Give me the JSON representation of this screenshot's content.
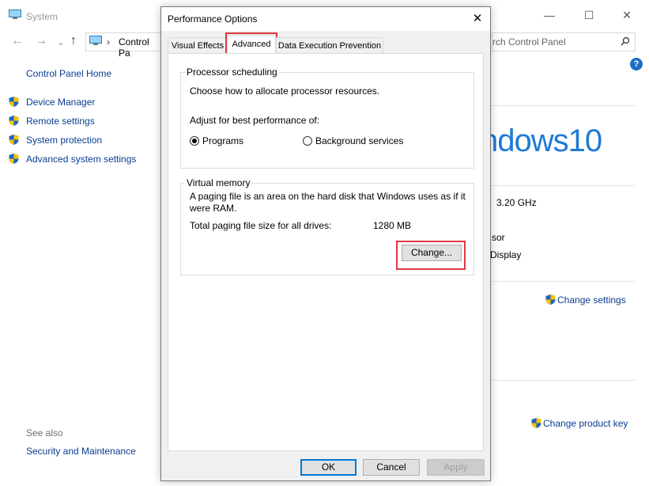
{
  "system_window": {
    "title": "System",
    "address": "Control Pa",
    "search_placeholder": "rch Control Panel",
    "sidebar": {
      "home": "Control Panel Home",
      "items": [
        {
          "label": "Device Manager",
          "icon": "shield-icon"
        },
        {
          "label": "Remote settings",
          "icon": "shield-icon"
        },
        {
          "label": "System protection",
          "icon": "shield-icon"
        },
        {
          "label": "Advanced system settings",
          "icon": "shield-icon"
        }
      ],
      "see_also": "See also",
      "see_also_items": [
        "Security and Maintenance"
      ]
    },
    "content": {
      "windows_logo_text": "ndows",
      "windows_logo_num": "10",
      "cpu_speed": "3.20 GHz",
      "processor_partial": "sor",
      "display_partial": "Display",
      "change_settings": "Change settings",
      "change_product_key": "Change product key"
    }
  },
  "dialog": {
    "title": "Performance Options",
    "tabs": [
      {
        "label": "Visual Effects",
        "active": false
      },
      {
        "label": "Advanced",
        "active": true
      },
      {
        "label": "Data Execution Prevention",
        "active": false
      }
    ],
    "processor_scheduling": {
      "title": "Processor scheduling",
      "description": "Choose how to allocate processor resources.",
      "adjust_label": "Adjust for best performance of:",
      "options": [
        {
          "label": "Programs",
          "selected": true
        },
        {
          "label": "Background services",
          "selected": false
        }
      ]
    },
    "virtual_memory": {
      "title": "Virtual memory",
      "description_line1": "A paging file is an area on the hard disk that Windows uses as if it",
      "description_line2": "were RAM.",
      "total_label": "Total paging file size for all drives:",
      "total_value": "1280 MB",
      "change_button": "Change..."
    },
    "buttons": {
      "ok": "OK",
      "cancel": "Cancel",
      "apply": "Apply"
    }
  },
  "colors": {
    "highlight": "#e0383e",
    "link": "#0b3d91",
    "win10_blue": "#1f7ad4"
  }
}
